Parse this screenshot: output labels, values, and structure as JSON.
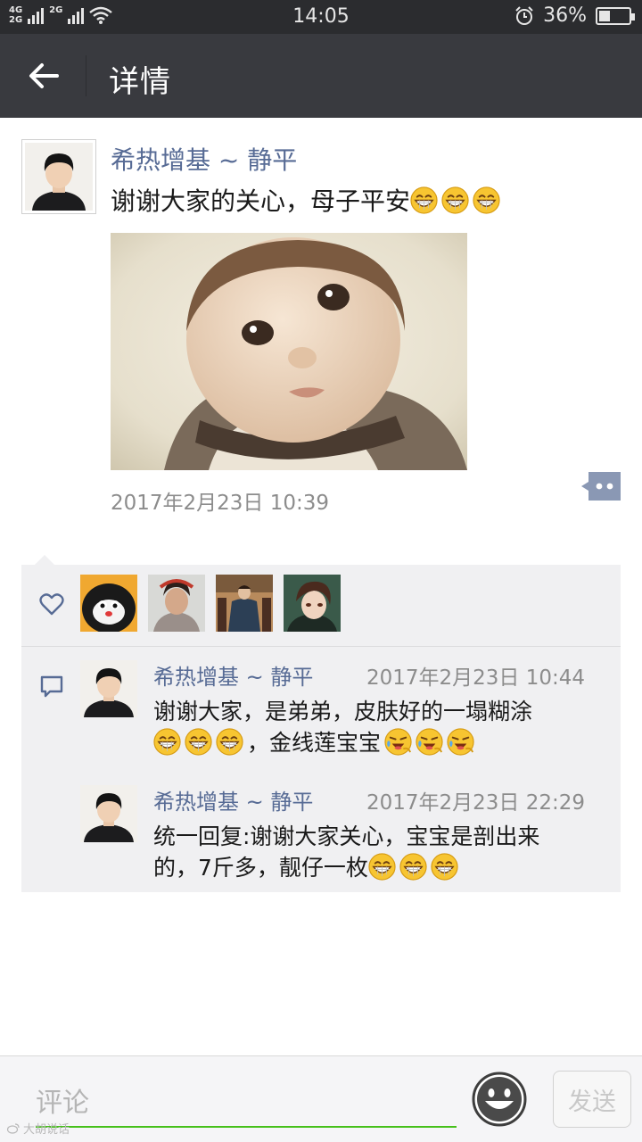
{
  "status_bar": {
    "network_top": "4G",
    "network_bottom": "2G",
    "network_second": "2G",
    "time": "14:05",
    "battery": "36%",
    "battery_level": 0.36,
    "icons": [
      "signal-icon",
      "wifi-icon",
      "alarm-icon",
      "battery-icon"
    ]
  },
  "title_bar": {
    "title": "详情",
    "back_icon": "arrow-left-icon"
  },
  "post": {
    "author": "希热增基 ~ 静平",
    "text": "谢谢大家的关心，母子平安",
    "emojis": [
      "grin",
      "grin",
      "grin"
    ],
    "time": "2017年2月23日 10:39",
    "more_icon": "comment-more-icon"
  },
  "likes": {
    "icon": "heart-icon",
    "avatars": [
      "panda-avatar",
      "girl-costume-avatar",
      "traditional-dress-avatar",
      "anime-boy-avatar"
    ]
  },
  "comments": [
    {
      "author": "希热增基 ~ 静平",
      "time": "2017年2月23日 10:44",
      "line1": "谢谢大家，是弟弟，皮肤好的一塌糊涂",
      "line2_prefix_emojis": [
        "grin",
        "grin",
        "grin"
      ],
      "line2_text": "，金线莲宝宝",
      "line2_suffix_emojis": [
        "laugh-tears",
        "laugh-tears",
        "laugh-tears"
      ]
    },
    {
      "author": "希热增基 ~ 静平",
      "time": "2017年2月23日 22:29",
      "line1": "统一回复:谢谢大家关心，宝宝是剖出来",
      "line2_text": "的，7斤多，靓仔一枚",
      "line2_suffix_emojis": [
        "grin",
        "grin",
        "grin"
      ]
    }
  ],
  "input_bar": {
    "placeholder": "评论",
    "send_label": "发送",
    "emoji_icon": "smiley-face-icon"
  },
  "watermark": "大胡说话"
}
